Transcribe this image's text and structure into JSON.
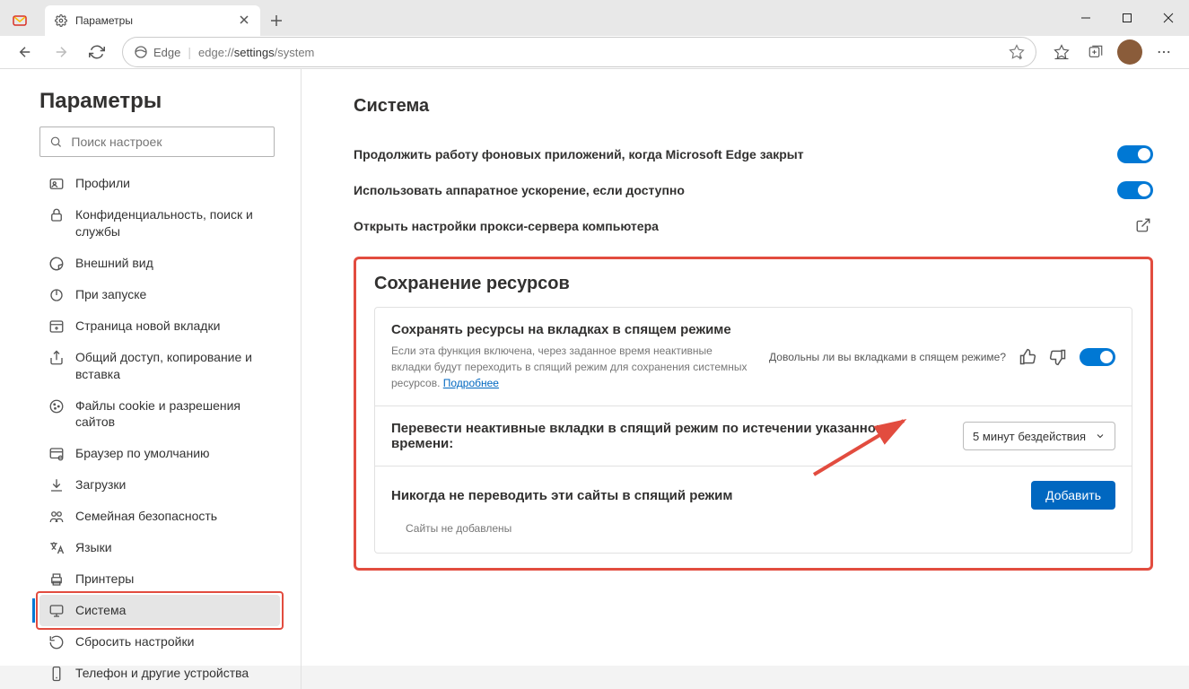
{
  "tab": {
    "title": "Параметры"
  },
  "address": {
    "prefix": "Edge",
    "url_prefix": "edge://",
    "url_mid": "settings",
    "url_suffix": "/system"
  },
  "sidebar": {
    "title": "Параметры",
    "search_placeholder": "Поиск настроек",
    "items": [
      {
        "label": "Профили"
      },
      {
        "label": "Конфиденциальность, поиск и службы"
      },
      {
        "label": "Внешний вид"
      },
      {
        "label": "При запуске"
      },
      {
        "label": "Страница новой вкладки"
      },
      {
        "label": "Общий доступ, копирование и вставка"
      },
      {
        "label": "Файлы cookie и разрешения сайтов"
      },
      {
        "label": "Браузер по умолчанию"
      },
      {
        "label": "Загрузки"
      },
      {
        "label": "Семейная безопасность"
      },
      {
        "label": "Языки"
      },
      {
        "label": "Принтеры"
      },
      {
        "label": "Система"
      },
      {
        "label": "Сбросить настройки"
      },
      {
        "label": "Телефон и другие устройства"
      }
    ]
  },
  "main": {
    "section_title": "Система",
    "row1": "Продолжить работу фоновых приложений, когда Microsoft Edge закрыт",
    "row2": "Использовать аппаратное ускорение, если доступно",
    "row3": "Открыть настройки прокси-сервера компьютера",
    "resource_title": "Сохранение ресурсов",
    "sleep": {
      "title": "Сохранять ресурсы на вкладках в спящем режиме",
      "desc": "Если эта функция включена, через заданное время неактивные вкладки будут переходить в спящий режим для сохранения системных ресурсов. ",
      "link": "Подробнее",
      "question": "Довольны ли вы вкладками в спящем режиме?"
    },
    "timeout": {
      "label": "Перевести неактивные вкладки в спящий режим по истечении указанного времени:",
      "value": "5 минут бездействия"
    },
    "never": {
      "label": "Никогда не переводить эти сайты в спящий режим",
      "add": "Добавить",
      "empty": "Сайты не добавлены"
    }
  }
}
